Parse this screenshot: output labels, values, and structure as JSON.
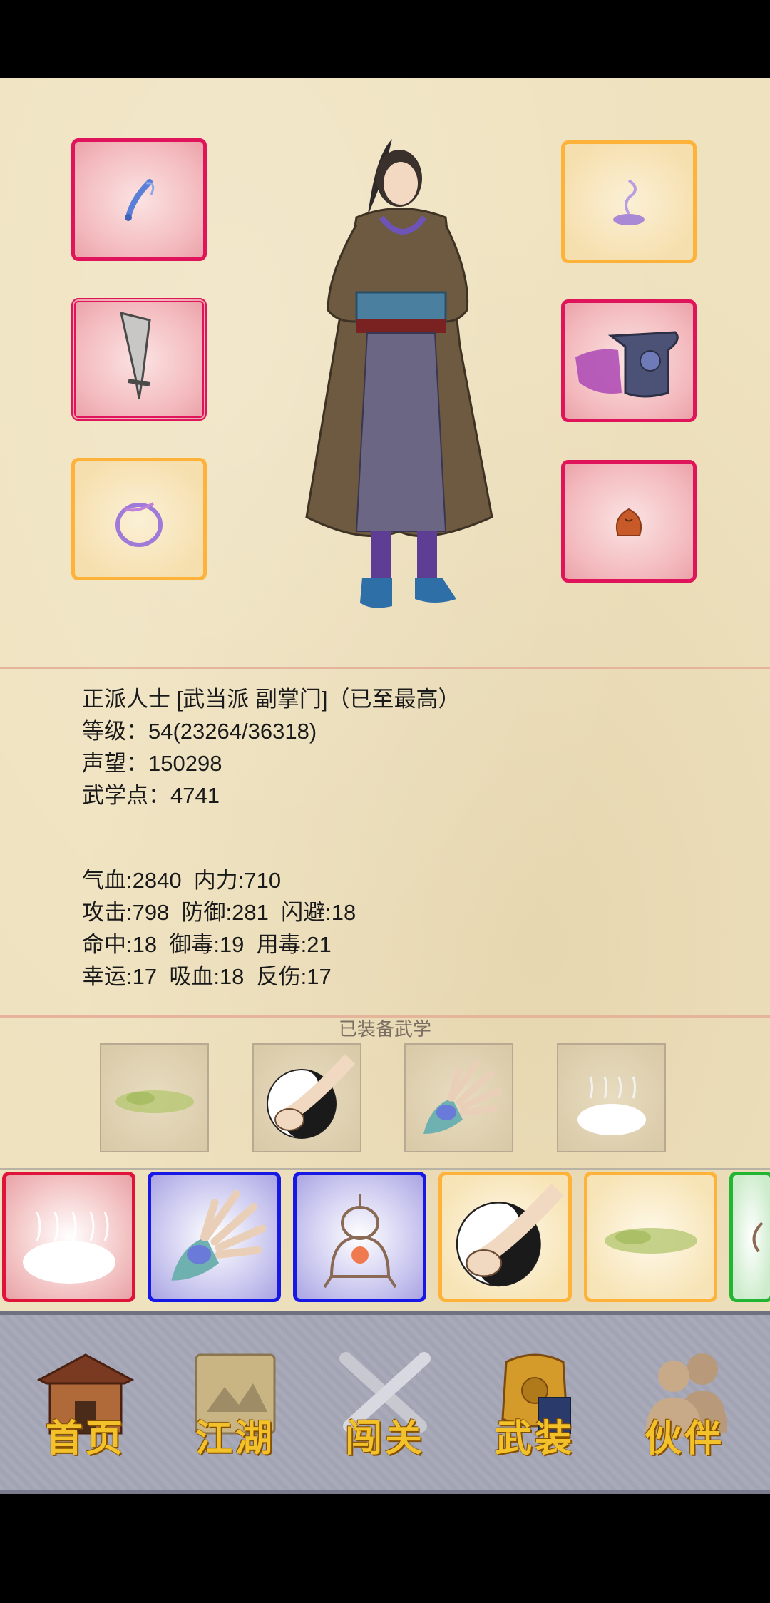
{
  "profile": {
    "title_line": "正派人士 [武当派 副掌门]（已至最高）",
    "level_line": "等级：54(23264/36318)",
    "reputation_line": "声望：150298",
    "martial_points_line": "武学点：4741"
  },
  "stats": {
    "line1": "气血:2840  内力:710",
    "line2": "攻击:798  防御:281  闪避:18",
    "line3": "命中:18  御毒:19  用毒:21",
    "line4": "幸运:17  吸血:18  反伤:17"
  },
  "equipped_skills": {
    "title": "已装备武学"
  },
  "equipment_slots": [
    {
      "side": "left",
      "rarity": "red",
      "icon": "flute-icon"
    },
    {
      "side": "left",
      "rarity": "red",
      "icon": "saber-icon"
    },
    {
      "side": "left",
      "rarity": "orange",
      "icon": "ring-icon"
    },
    {
      "side": "right",
      "rarity": "orange",
      "icon": "incense-icon"
    },
    {
      "side": "right",
      "rarity": "red",
      "icon": "armor-icon"
    },
    {
      "side": "right",
      "rarity": "red",
      "icon": "amulet-icon"
    }
  ],
  "skill_slots": [
    "mist-icon",
    "taiji-fist-icon",
    "palm-icon",
    "cloud-icon"
  ],
  "bag_items": [
    {
      "rarity": "red",
      "icon": "cloud-icon"
    },
    {
      "rarity": "blue",
      "icon": "palm-icon"
    },
    {
      "rarity": "blue",
      "icon": "bell-icon"
    },
    {
      "rarity": "orange",
      "icon": "taiji-fist-icon"
    },
    {
      "rarity": "orange",
      "icon": "mist-icon"
    },
    {
      "rarity": "green",
      "icon": "partial-item-icon"
    }
  ],
  "nav": {
    "home": "首页",
    "jianghu": "江湖",
    "challenge": "闯关",
    "equipment": "武装",
    "partner": "伙伴"
  },
  "colors": {
    "red_rarity": "#e0145a",
    "orange_rarity": "#ffb23a",
    "blue_rarity": "#1717e6",
    "green_rarity": "#22b433",
    "nav_label": "#f3c22a"
  }
}
